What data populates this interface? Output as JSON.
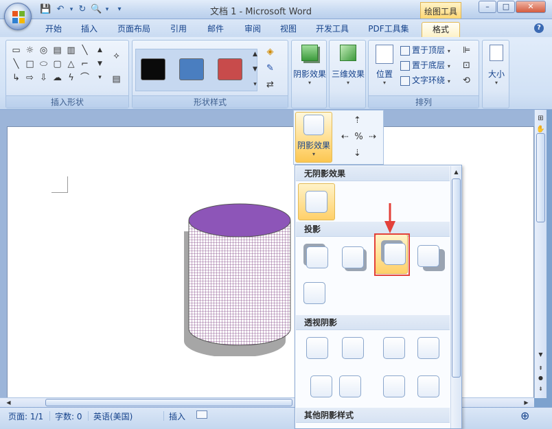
{
  "window": {
    "title": "文档 1 - Microsoft Word",
    "contextual_tab_group": "绘图工具",
    "controls": [
      "–",
      "□",
      "✕"
    ]
  },
  "ribbon_tabs": [
    {
      "label": "开始",
      "active": false
    },
    {
      "label": "插入",
      "active": false
    },
    {
      "label": "页面布局",
      "active": false
    },
    {
      "label": "引用",
      "active": false
    },
    {
      "label": "邮件",
      "active": false
    },
    {
      "label": "审阅",
      "active": false
    },
    {
      "label": "视图",
      "active": false
    },
    {
      "label": "开发工具",
      "active": false
    },
    {
      "label": "PDF工具集",
      "active": false
    },
    {
      "label": "格式",
      "active": true
    }
  ],
  "groups": {
    "insert_shapes": {
      "label": "插入形状"
    },
    "shape_styles": {
      "label": "形状样式",
      "swatches": [
        "#0a0a0a",
        "#4a7ec0",
        "#c84b4b"
      ]
    },
    "shadow_effects": {
      "label": "阴影效果"
    },
    "three_d": {
      "label": "三维效果"
    },
    "arrange": {
      "label": "排列",
      "position": "位置",
      "bring_front": "置于顶层",
      "send_back": "置于底层",
      "text_wrap": "文字环绕"
    },
    "size": {
      "label": "大小"
    }
  },
  "shadow_gallery": {
    "button_label": "阴影效果",
    "section_none": "无阴影效果",
    "section_drop": "投影",
    "section_perspective": "透视阴影",
    "section_other": "其他阴影样式",
    "selected_option": "投影 第3项"
  },
  "statusbar": {
    "page": "页面: 1/1",
    "words": "字数: 0",
    "language": "英语(美国)",
    "mode": "插入"
  },
  "shape_colors": {
    "top": "#8d55b8",
    "body_pattern": "#7a3b7e",
    "shadow": "#a6a6a6"
  }
}
